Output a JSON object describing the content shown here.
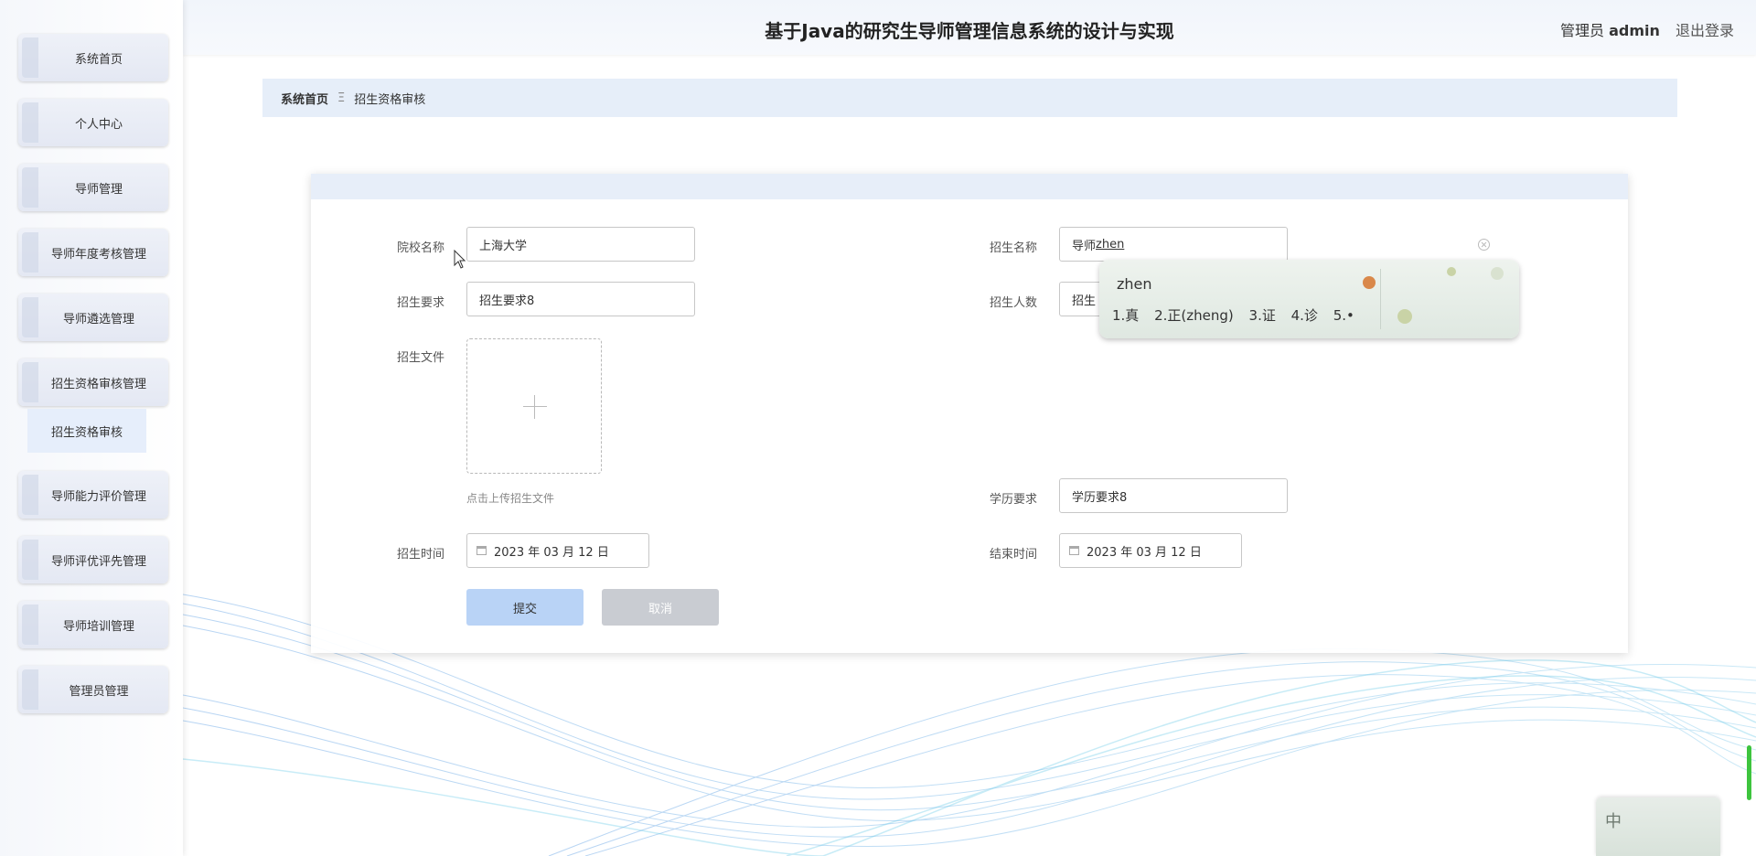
{
  "header": {
    "title": "基于Java的研究生导师管理信息系统的设计与实现",
    "role": "管理员",
    "username": "admin",
    "logout": "退出登录"
  },
  "sidebar": {
    "items": [
      {
        "label": "系统首页"
      },
      {
        "label": "个人中心"
      },
      {
        "label": "导师管理"
      },
      {
        "label": "导师年度考核管理"
      },
      {
        "label": "导师遴选管理"
      },
      {
        "label": "招生资格审核管理"
      },
      {
        "label": "导师能力评价管理"
      },
      {
        "label": "导师评优评先管理"
      },
      {
        "label": "导师培训管理"
      },
      {
        "label": "管理员管理"
      }
    ],
    "sub_item": "招生资格审核"
  },
  "breadcrumb": {
    "home": "系统首页",
    "separator": "Ξ",
    "current": "招生资格审核"
  },
  "form": {
    "school_label": "院校名称",
    "school_value": "上海大学",
    "enroll_name_label": "招生名称",
    "enroll_name_prefix": "导师",
    "enroll_name_typing": "zhen",
    "requirement_label": "招生要求",
    "requirement_value": "招生要求8",
    "count_label": "招生人数",
    "count_value": "招生",
    "file_label": "招生文件",
    "file_hint": "点击上传招生文件",
    "edu_label": "学历要求",
    "edu_value": "学历要求8",
    "start_label": "招生时间",
    "start_value": "2023 年 03 月 12 日",
    "end_label": "结束时间",
    "end_value": "2023 年 03 月 12 日",
    "submit": "提交",
    "cancel": "取消"
  },
  "ime": {
    "composition": "zhen",
    "candidates": [
      "1.真",
      "2.正(zheng)",
      "3.证",
      "4.诊",
      "5.•"
    ],
    "status_char": "中"
  },
  "colors": {
    "header_bg": "#f1f5fb",
    "breadcrumb_bg": "#e6eef9",
    "submit_bg": "#b9d3f6",
    "cancel_bg": "#c9ccd2"
  }
}
